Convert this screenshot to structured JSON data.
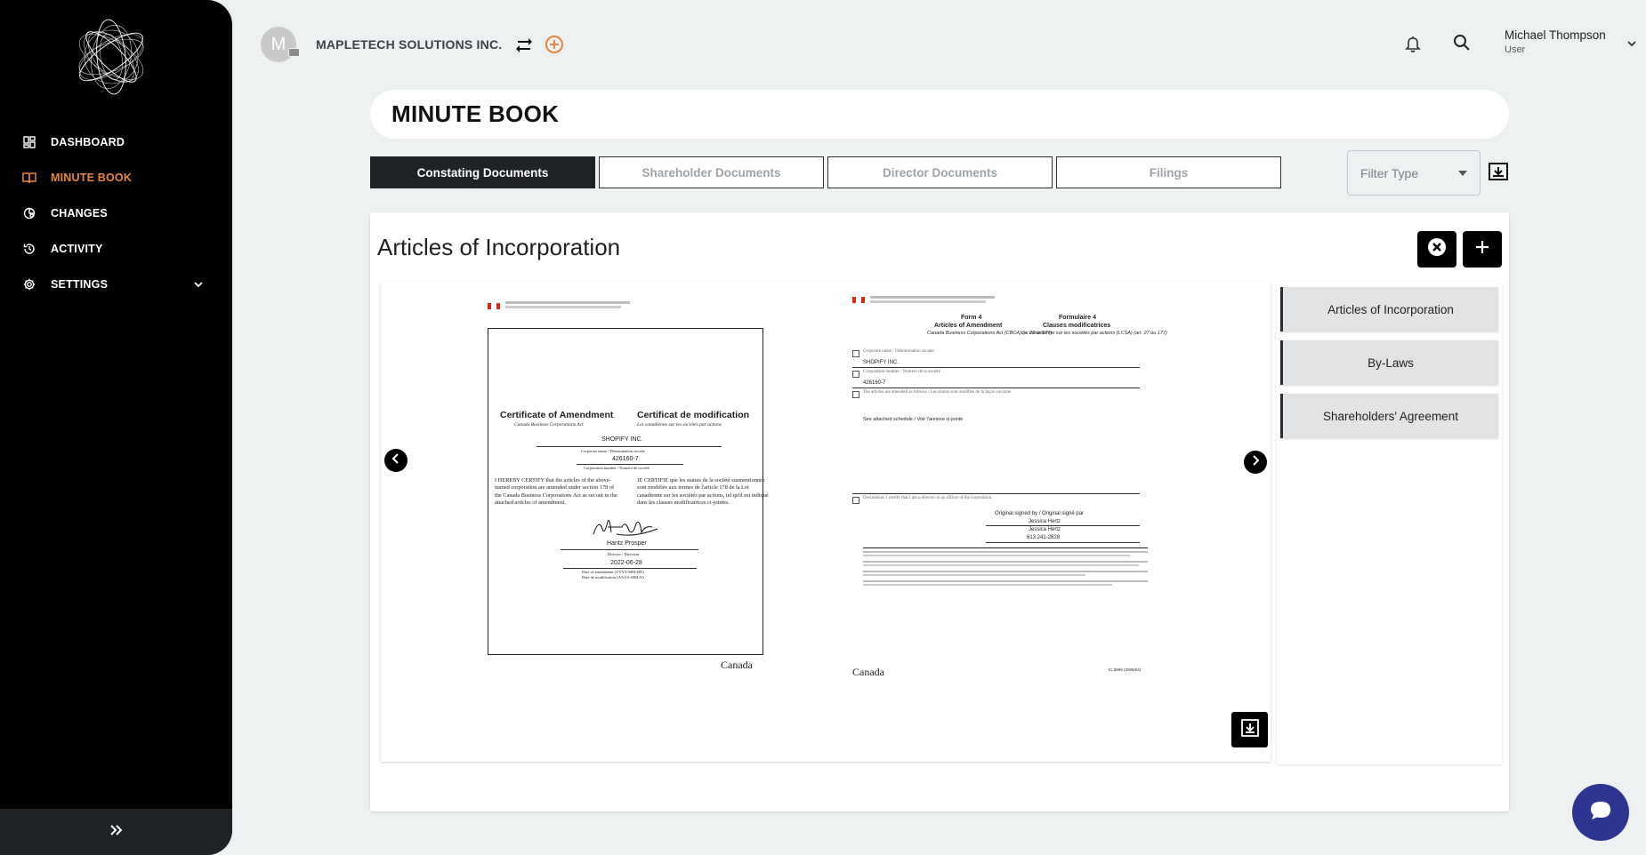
{
  "sidebar": {
    "items": [
      {
        "label": "DASHBOARD",
        "icon": "dashboard-icon"
      },
      {
        "label": "MINUTE BOOK",
        "icon": "book-icon"
      },
      {
        "label": "CHANGES",
        "icon": "changes-icon"
      },
      {
        "label": "ACTIVITY",
        "icon": "history-icon"
      },
      {
        "label": "SETTINGS",
        "icon": "gear-icon"
      }
    ],
    "active": "MINUTE BOOK",
    "active_color": "#e8863b"
  },
  "header": {
    "avatar_letter": "M",
    "company": "MAPLETECH SOLUTIONS INC.",
    "user_name": "Michael Thompson",
    "user_role": "User"
  },
  "page": {
    "title": "MINUTE BOOK"
  },
  "tabs": [
    {
      "label": "Constating Documents",
      "active": true
    },
    {
      "label": "Shareholder Documents",
      "active": false
    },
    {
      "label": "Director Documents",
      "active": false
    },
    {
      "label": "Filings",
      "active": false
    }
  ],
  "filter": {
    "placeholder": "Filter Type"
  },
  "section": {
    "title": "Articles of Incorporation"
  },
  "documents": [
    {
      "label": "Articles of Incorporation"
    },
    {
      "label": "By-Laws"
    },
    {
      "label": "Shareholders' Agreement"
    }
  ],
  "preview": {
    "left_page": {
      "title_en": "Certificate of Amendment",
      "title_fr": "Certificat de modification",
      "act_en": "Canada Business Corporations Act",
      "act_fr": "Loi canadienne sur les sociétés par actions",
      "corp_name": "SHOPIFY INC.",
      "corp_name_label": "Corporate name / Dénomination sociale",
      "corp_number": "426160-7",
      "corp_number_label": "Corporation number / Numéro de société",
      "certify_en": "I HEREBY CERTIFY that the articles of the above-named corporation are amended under section 178 of the Canada Business Corporations Act as set out in the attached articles of amendment.",
      "certify_fr": "JE CERTIFIE que les statuts de la société susmentionnée sont modifiés aux termes de l'article 178 de la Loi canadienne sur les sociétés par actions, tel qu'il est indiqué dans les clauses modificatrices ci-jointes.",
      "signer": "Hantz Prosper",
      "signer_title": "Director / Directeur",
      "date": "2022-06-28",
      "date_label_en": "Date of amendment (YYYY-MM-DD)",
      "date_label_fr": "Date de modification (AAAA-MM-JJ)",
      "footer_mark": "Canada"
    },
    "right_page": {
      "form_en": "Form 4",
      "form_en_title": "Articles of Amendment",
      "form_en_act": "Canada Business Corporations Act (CBCA) (s. 27 or 177)",
      "form_fr": "Formulaire 4",
      "form_fr_title": "Clauses modificatrices",
      "form_fr_act": "Loi canadienne sur les sociétés par actions (LCSA) (art. 27 ou 177)",
      "field1_label": "Corporate name / Dénomination sociale",
      "field1_value": "SHOPIFY INC.",
      "field2_label": "Corporation number / Numéro de la société",
      "field2_value": "426160-7",
      "field3_label": "The articles are amended as follows / Les statuts sont modifiés de la façon suivante",
      "field3_value": "See attached schedule / Voir l'annexe ci-jointe",
      "field4_label": "Declaration: I certify that I am a director or an officer of the corporation.",
      "signed_by": "Original signed by / Original signé par",
      "signer": "Jessica Hertz",
      "signer2": "Jessica Hertz",
      "phone": "613 241-2828",
      "form_code": "IC 3069 (2008/04)",
      "footer_mark": "Canada"
    }
  }
}
